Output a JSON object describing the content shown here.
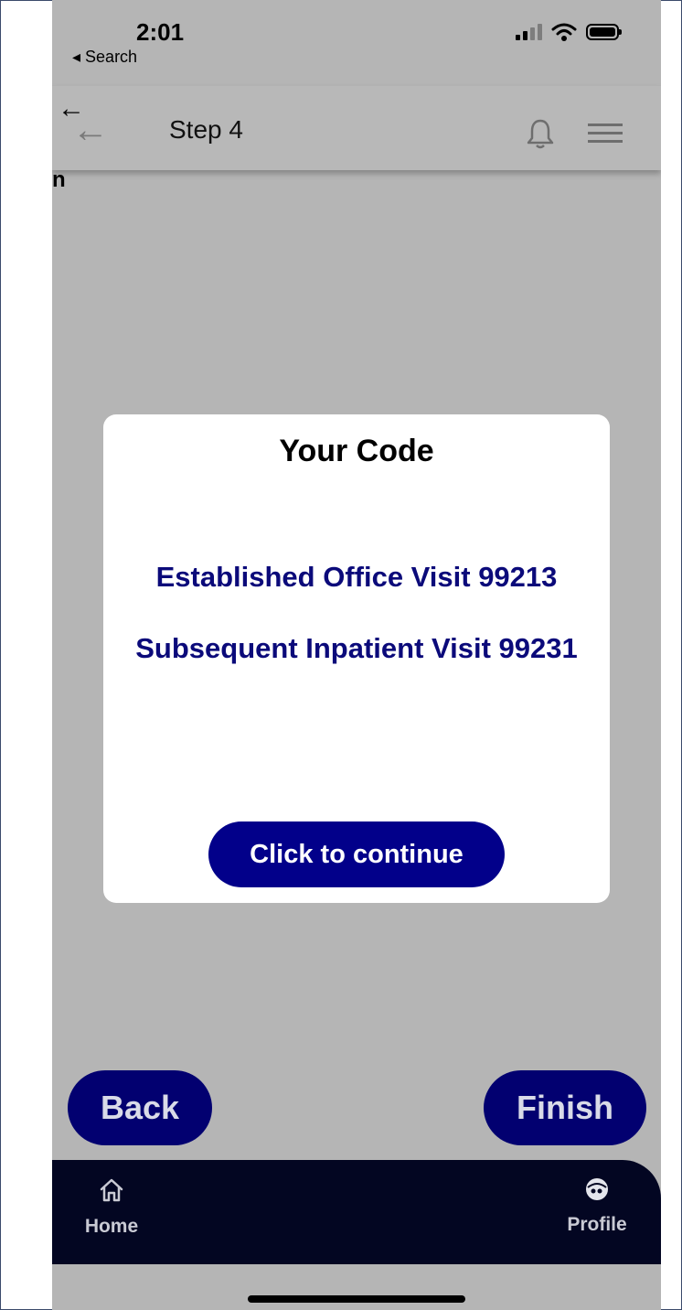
{
  "status_bar": {
    "time": "2:01",
    "back_label": "◂ Search"
  },
  "header": {
    "title": "Step 4"
  },
  "background": {
    "fragment": "n"
  },
  "modal": {
    "title": "Your Code",
    "codes": [
      "Established Office Visit 99213",
      "Subsequent Inpatient Visit 99231"
    ],
    "continue_label": "Click to continue"
  },
  "actions": {
    "back_label": "Back",
    "finish_label": "Finish"
  },
  "bottom_nav": {
    "items": [
      {
        "label": "Home",
        "icon": "home-icon"
      },
      {
        "label": "Profile",
        "icon": "profile-icon"
      }
    ]
  },
  "colors": {
    "primary": "#02008a",
    "code_text": "#0b0a7a",
    "nav_bg": "#030622",
    "overlay_bg": "#b5b5b5"
  }
}
